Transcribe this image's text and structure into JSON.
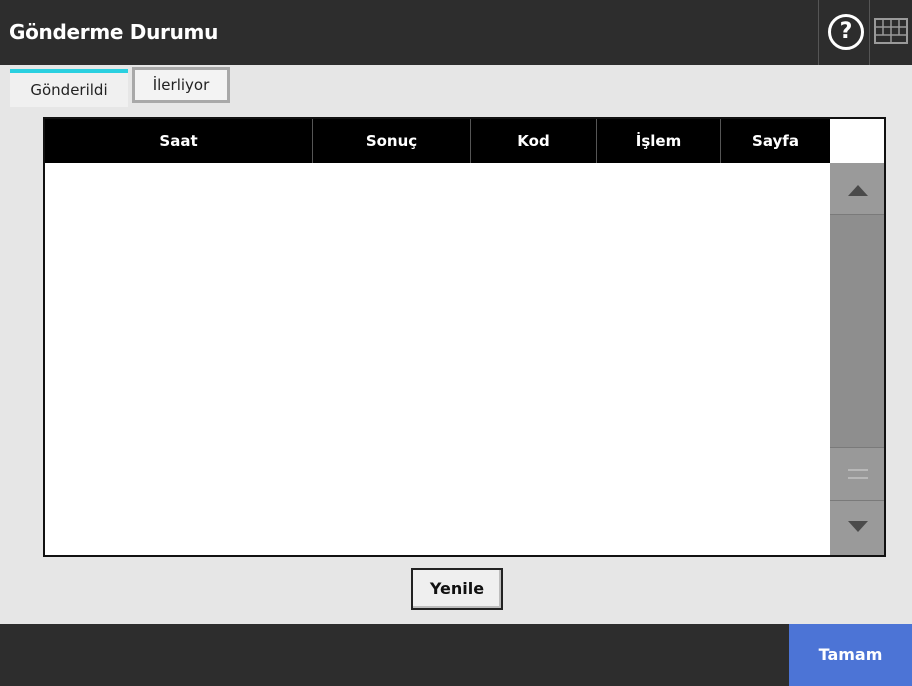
{
  "header": {
    "title": "Gönderme Durumu",
    "help_icon": "help-circle-icon",
    "keyboard_icon": "keyboard-icon"
  },
  "tabs": [
    {
      "label": "Gönderildi",
      "active": true
    },
    {
      "label": "İlerliyor",
      "active": false
    }
  ],
  "table": {
    "columns": [
      "Saat",
      "Sonuç",
      "Kod",
      "İşlem",
      "Sayfa"
    ],
    "rows": []
  },
  "buttons": {
    "refresh": "Yenile",
    "ok": "Tamam"
  },
  "colors": {
    "header_bg": "#2d2d2d",
    "tab_accent": "#2ad0e0",
    "ok_button": "#4c74d6"
  }
}
